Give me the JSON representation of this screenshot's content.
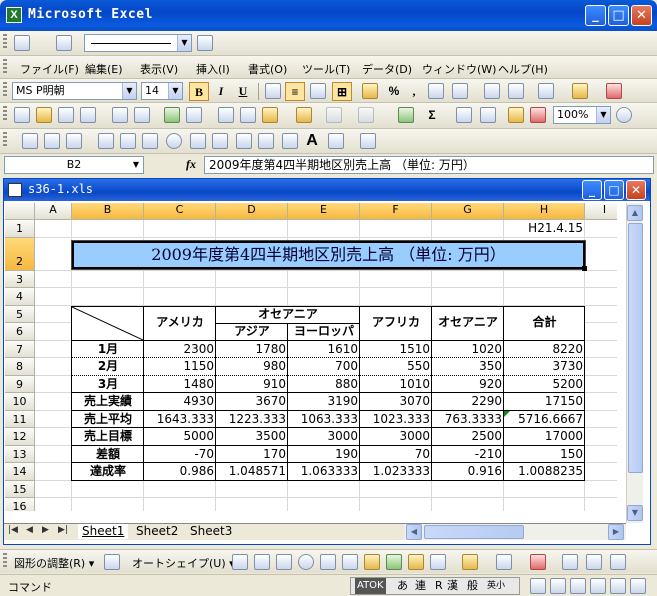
{
  "app": {
    "title": "Microsoft Excel",
    "icon_letter": "X"
  },
  "window_buttons": {
    "min": "_",
    "max": "□",
    "close": "✕"
  },
  "menu": [
    "ファイル(F)",
    "編集(E)",
    "表示(V)",
    "挿入(I)",
    "書式(O)",
    "ツール(T)",
    "データ(D)",
    "ウィンドウ(W)",
    "ヘルプ(H)"
  ],
  "format_toolbar": {
    "font": "MS P明朝",
    "size": "14",
    "bold": "B",
    "italic": "I",
    "underline": "U",
    "percent": "%",
    "comma": ","
  },
  "standard_toolbar": {
    "zoom": "100%",
    "sigma": "Σ"
  },
  "formula_bar": {
    "name_box": "B2",
    "fx": "fx",
    "content": "2009年度第4四半期地区別売上高 （単位: 万円）"
  },
  "workbook": {
    "title": "s36-1.xls"
  },
  "columns": [
    "A",
    "B",
    "C",
    "D",
    "E",
    "F",
    "G",
    "H",
    "I"
  ],
  "rows": [
    "1",
    "2",
    "3",
    "4",
    "5",
    "6",
    "7",
    "8",
    "9",
    "10",
    "11",
    "12",
    "13",
    "14",
    "15",
    "16"
  ],
  "sheet": {
    "date": "H21.4.15",
    "title": "2009年度第4四半期地区別売上高 （単位: 万円）",
    "headers": {
      "america": "アメリカ",
      "oceania_group": "オセアニア",
      "asia": "アジア",
      "europe": "ヨーロッパ",
      "africa": "アフリカ",
      "oceania": "オセアニア",
      "total": "合計"
    },
    "table": [
      {
        "label": "1月",
        "values": [
          "2300",
          "1780",
          "1610",
          "1510",
          "1020",
          "8220"
        ]
      },
      {
        "label": "2月",
        "values": [
          "1150",
          "980",
          "700",
          "550",
          "350",
          "3730"
        ]
      },
      {
        "label": "3月",
        "values": [
          "1480",
          "910",
          "880",
          "1010",
          "920",
          "5200"
        ]
      },
      {
        "label": "売上実績",
        "values": [
          "4930",
          "3670",
          "3190",
          "3070",
          "2290",
          "17150"
        ]
      },
      {
        "label": "売上平均",
        "values": [
          "1643.333",
          "1223.333",
          "1063.333",
          "1023.333",
          "763.3333",
          "5716.6667"
        ]
      },
      {
        "label": "売上目標",
        "values": [
          "5000",
          "3500",
          "3000",
          "3000",
          "2500",
          "17000"
        ]
      },
      {
        "label": "差額",
        "values": [
          "-70",
          "170",
          "190",
          "70",
          "-210",
          "150"
        ]
      },
      {
        "label": "達成率",
        "values": [
          "0.986",
          "1.048571",
          "1.063333",
          "1.023333",
          "0.916",
          "1.0088235"
        ]
      }
    ]
  },
  "sheet_tabs": [
    "Sheet1",
    "Sheet2",
    "Sheet3"
  ],
  "tab_nav": [
    "|◀",
    "◀",
    "▶",
    "▶|"
  ],
  "draw_toolbar": {
    "adjust": "図形の調整(R) ▾",
    "autoshape": "オートシェイプ(U) ▾"
  },
  "status": {
    "mode": "コマンド",
    "ime": "ATOK",
    "ime_chars": [
      "あ",
      "連",
      "R",
      "漢",
      "般",
      "英小"
    ]
  },
  "colors": {
    "title_fill": "#99ccff",
    "title_text": "#000033",
    "selected_header": "#f5b840"
  }
}
